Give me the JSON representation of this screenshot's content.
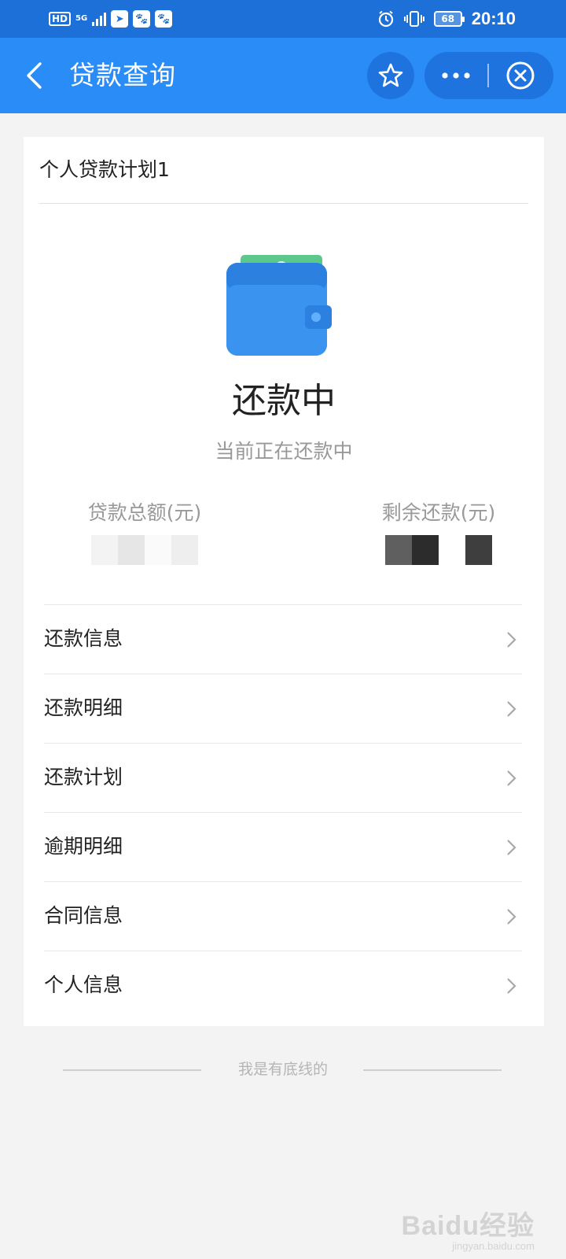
{
  "status_bar": {
    "left_indicators": [
      "HD",
      "5G"
    ],
    "battery": "68",
    "time": "20:10",
    "icons": [
      "hd-icon",
      "5g-icon",
      "signal-icon",
      "app-notification-icon",
      "baidu-icon",
      "baidu-icon",
      "alarm-icon",
      "vibrate-icon",
      "battery-icon"
    ]
  },
  "nav": {
    "title": "贷款查询",
    "icons": [
      "back-icon",
      "star-icon",
      "more-icon",
      "close-circle-icon"
    ]
  },
  "card": {
    "plan_title": "个人贷款计划1",
    "status": "还款中",
    "status_desc": "当前正在还款中",
    "total_label": "贷款总额(元)",
    "remaining_label": "剩余还款(元)",
    "menu": [
      {
        "label": "还款信息"
      },
      {
        "label": "还款明细"
      },
      {
        "label": "还款计划"
      },
      {
        "label": "逾期明细"
      },
      {
        "label": "合同信息"
      },
      {
        "label": "个人信息"
      }
    ]
  },
  "footer": {
    "text": "我是有底线的"
  },
  "watermark": {
    "main": "Baidu经验",
    "sub": "jingyan.baidu.com"
  },
  "colors": {
    "status_bar": "#1d70d8",
    "nav_bar": "#2a8cf7",
    "nav_button_bg": "#1e73df",
    "page_bg": "#f3f3f3",
    "card_bg": "#ffffff"
  }
}
